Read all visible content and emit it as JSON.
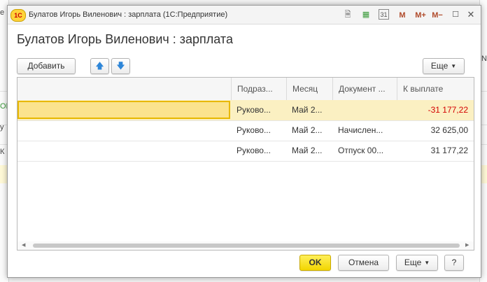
{
  "window": {
    "logo": "1С",
    "title": "Булатов Игорь Виленович : зарплата  (1С:Предприятие)",
    "toolbar_icons": [
      "document-icon",
      "table-icon",
      "calendar-icon"
    ],
    "calendar_day": "31",
    "memory_buttons": [
      "M",
      "M+",
      "M−"
    ]
  },
  "form": {
    "title": "Булатов Игорь Виленович : зарплата",
    "toolbar": {
      "add_label": "Добавить",
      "more_label": "Еще"
    }
  },
  "table": {
    "columns": [
      "Подраз...",
      "Месяц",
      "Документ ...",
      "К выплате"
    ],
    "rows": [
      {
        "dept": "Руково...",
        "month": "Май 2...",
        "doc": "",
        "amount": "-31 177,22",
        "selected": true
      },
      {
        "dept": "Руково...",
        "month": "Май 2...",
        "doc": "Начислен...",
        "amount": "32 625,00"
      },
      {
        "dept": "Руково...",
        "month": "Май 2...",
        "doc": "Отпуск 00...",
        "amount": "31 177,22"
      }
    ]
  },
  "footer": {
    "ok_label": "OK",
    "cancel_label": "Отмена",
    "more_label": "Еще",
    "help_label": "?"
  },
  "background": {
    "left_fragments": [
      "е",
      "ОК",
      "у",
      "К"
    ],
    "right_fragment": "N"
  }
}
